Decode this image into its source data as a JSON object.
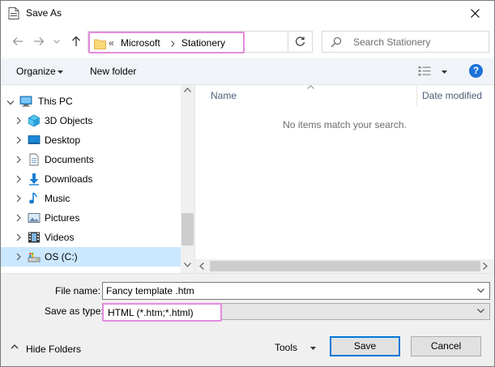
{
  "window": {
    "title": "Save As"
  },
  "address": {
    "overflow_indicator": "«",
    "breadcrumbs": [
      "Microsoft",
      "Stationery"
    ]
  },
  "search": {
    "placeholder": "Search Stationery"
  },
  "toolbar": {
    "organize_label": "Organize",
    "new_folder_label": "New folder",
    "help_label": "?"
  },
  "nav_tree": {
    "root": "This PC",
    "items": [
      {
        "label": "3D Objects",
        "icon": "3d-objects-icon"
      },
      {
        "label": "Desktop",
        "icon": "desktop-icon"
      },
      {
        "label": "Documents",
        "icon": "documents-icon"
      },
      {
        "label": "Downloads",
        "icon": "downloads-icon"
      },
      {
        "label": "Music",
        "icon": "music-icon"
      },
      {
        "label": "Pictures",
        "icon": "pictures-icon"
      },
      {
        "label": "Videos",
        "icon": "videos-icon"
      },
      {
        "label": "OS (C:)",
        "icon": "drive-icon",
        "selected": true
      }
    ]
  },
  "file_list": {
    "columns": [
      "Name",
      "Date modified"
    ],
    "empty_message": "No items match your search."
  },
  "form": {
    "file_name_label": "File name:",
    "file_name_value": "Fancy template .htm",
    "save_as_type_label": "Save as type:",
    "save_as_type_value": "HTML (*.htm;*.html)"
  },
  "footer": {
    "hide_folders_label": "Hide Folders",
    "tools_label": "Tools",
    "save_label": "Save",
    "cancel_label": "Cancel"
  },
  "colors": {
    "accent": "#0078d7",
    "highlight": "#e48bdc",
    "selection": "#cce8ff",
    "toolbar_bg": "#f0f4f9"
  }
}
